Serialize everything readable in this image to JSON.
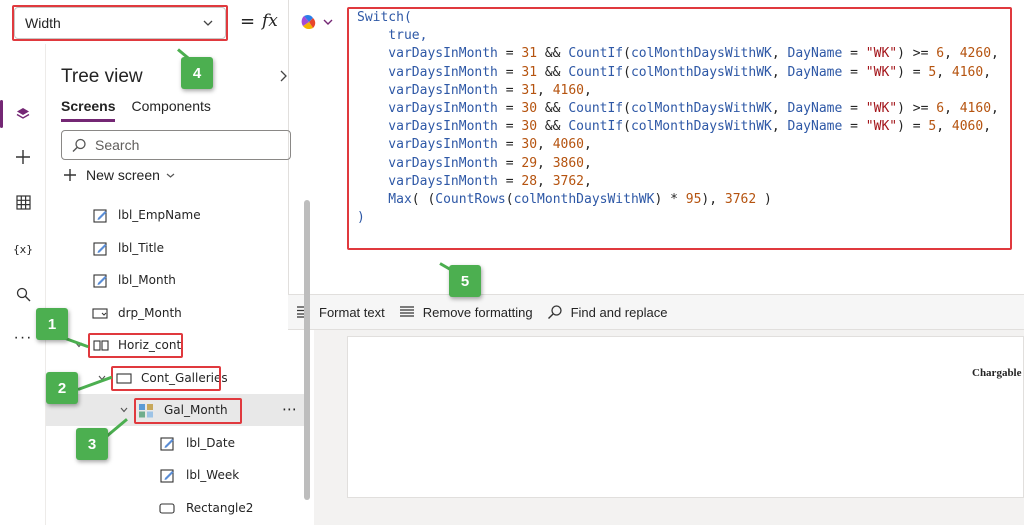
{
  "formula_bar": {
    "property": "Width",
    "equals": "=",
    "fx": "fx"
  },
  "formula": {
    "lines": [
      [
        {
          "t": "Switch(",
          "c": "c-fn"
        }
      ],
      [
        {
          "t": "    true,",
          "c": "c-fn"
        }
      ],
      [
        {
          "t": "    varDaysInMonth",
          "c": "c-id"
        },
        {
          "t": " = ",
          "c": "c-op"
        },
        {
          "t": "31",
          "c": "c-num"
        },
        {
          "t": " && ",
          "c": "c-op"
        },
        {
          "t": "CountIf",
          "c": "c-fn"
        },
        {
          "t": "(",
          "c": "c-op"
        },
        {
          "t": "colMonthDaysWithWK",
          "c": "c-id"
        },
        {
          "t": ", ",
          "c": "c-op"
        },
        {
          "t": "DayName",
          "c": "c-id"
        },
        {
          "t": " = ",
          "c": "c-op"
        },
        {
          "t": "\"WK\"",
          "c": "c-str"
        },
        {
          "t": ") >= ",
          "c": "c-op"
        },
        {
          "t": "6",
          "c": "c-num"
        },
        {
          "t": ", ",
          "c": "c-op"
        },
        {
          "t": "4260",
          "c": "c-num"
        },
        {
          "t": ",",
          "c": "c-op"
        }
      ],
      [
        {
          "t": "    varDaysInMonth",
          "c": "c-id"
        },
        {
          "t": " = ",
          "c": "c-op"
        },
        {
          "t": "31",
          "c": "c-num"
        },
        {
          "t": " && ",
          "c": "c-op"
        },
        {
          "t": "CountIf",
          "c": "c-fn"
        },
        {
          "t": "(",
          "c": "c-op"
        },
        {
          "t": "colMonthDaysWithWK",
          "c": "c-id"
        },
        {
          "t": ", ",
          "c": "c-op"
        },
        {
          "t": "DayName",
          "c": "c-id"
        },
        {
          "t": " = ",
          "c": "c-op"
        },
        {
          "t": "\"WK\"",
          "c": "c-str"
        },
        {
          "t": ") = ",
          "c": "c-op"
        },
        {
          "t": "5",
          "c": "c-num"
        },
        {
          "t": ", ",
          "c": "c-op"
        },
        {
          "t": "4160",
          "c": "c-num"
        },
        {
          "t": ",",
          "c": "c-op"
        }
      ],
      [
        {
          "t": "    varDaysInMonth",
          "c": "c-id"
        },
        {
          "t": " = ",
          "c": "c-op"
        },
        {
          "t": "31",
          "c": "c-num"
        },
        {
          "t": ", ",
          "c": "c-op"
        },
        {
          "t": "4160",
          "c": "c-num"
        },
        {
          "t": ",",
          "c": "c-op"
        }
      ],
      [
        {
          "t": "    varDaysInMonth",
          "c": "c-id"
        },
        {
          "t": " = ",
          "c": "c-op"
        },
        {
          "t": "30",
          "c": "c-num"
        },
        {
          "t": " && ",
          "c": "c-op"
        },
        {
          "t": "CountIf",
          "c": "c-fn"
        },
        {
          "t": "(",
          "c": "c-op"
        },
        {
          "t": "colMonthDaysWithWK",
          "c": "c-id"
        },
        {
          "t": ", ",
          "c": "c-op"
        },
        {
          "t": "DayName",
          "c": "c-id"
        },
        {
          "t": " = ",
          "c": "c-op"
        },
        {
          "t": "\"WK\"",
          "c": "c-str"
        },
        {
          "t": ") >= ",
          "c": "c-op"
        },
        {
          "t": "6",
          "c": "c-num"
        },
        {
          "t": ", ",
          "c": "c-op"
        },
        {
          "t": "4160",
          "c": "c-num"
        },
        {
          "t": ",",
          "c": "c-op"
        }
      ],
      [
        {
          "t": "    varDaysInMonth",
          "c": "c-id"
        },
        {
          "t": " = ",
          "c": "c-op"
        },
        {
          "t": "30",
          "c": "c-num"
        },
        {
          "t": " && ",
          "c": "c-op"
        },
        {
          "t": "CountIf",
          "c": "c-fn"
        },
        {
          "t": "(",
          "c": "c-op"
        },
        {
          "t": "colMonthDaysWithWK",
          "c": "c-id"
        },
        {
          "t": ", ",
          "c": "c-op"
        },
        {
          "t": "DayName",
          "c": "c-id"
        },
        {
          "t": " = ",
          "c": "c-op"
        },
        {
          "t": "\"WK\"",
          "c": "c-str"
        },
        {
          "t": ") = ",
          "c": "c-op"
        },
        {
          "t": "5",
          "c": "c-num"
        },
        {
          "t": ", ",
          "c": "c-op"
        },
        {
          "t": "4060",
          "c": "c-num"
        },
        {
          "t": ",",
          "c": "c-op"
        }
      ],
      [
        {
          "t": "    varDaysInMonth",
          "c": "c-id"
        },
        {
          "t": " = ",
          "c": "c-op"
        },
        {
          "t": "30",
          "c": "c-num"
        },
        {
          "t": ", ",
          "c": "c-op"
        },
        {
          "t": "4060",
          "c": "c-num"
        },
        {
          "t": ",",
          "c": "c-op"
        }
      ],
      [
        {
          "t": "    varDaysInMonth",
          "c": "c-id"
        },
        {
          "t": " = ",
          "c": "c-op"
        },
        {
          "t": "29",
          "c": "c-num"
        },
        {
          "t": ", ",
          "c": "c-op"
        },
        {
          "t": "3860",
          "c": "c-num"
        },
        {
          "t": ",",
          "c": "c-op"
        }
      ],
      [
        {
          "t": "    varDaysInMonth",
          "c": "c-id"
        },
        {
          "t": " = ",
          "c": "c-op"
        },
        {
          "t": "28",
          "c": "c-num"
        },
        {
          "t": ", ",
          "c": "c-op"
        },
        {
          "t": "3762",
          "c": "c-num"
        },
        {
          "t": ",",
          "c": "c-op"
        }
      ],
      [
        {
          "t": "    Max",
          "c": "c-fn"
        },
        {
          "t": "( (",
          "c": "c-op"
        },
        {
          "t": "CountRows",
          "c": "c-fn"
        },
        {
          "t": "(",
          "c": "c-op"
        },
        {
          "t": "colMonthDaysWithWK",
          "c": "c-id"
        },
        {
          "t": ") * ",
          "c": "c-op"
        },
        {
          "t": "95",
          "c": "c-num"
        },
        {
          "t": "), ",
          "c": "c-op"
        },
        {
          "t": "3762",
          "c": "c-num"
        },
        {
          "t": " )",
          "c": "c-op"
        }
      ],
      [
        {
          "t": ")",
          "c": "c-fn"
        }
      ]
    ]
  },
  "format_toolbar": {
    "format_text": "Format text",
    "remove_formatting": "Remove formatting",
    "find_replace": "Find and replace"
  },
  "tree_view": {
    "title": "Tree view",
    "tabs": [
      "Screens",
      "Components"
    ],
    "search_placeholder": "Search",
    "new_screen": "New screen",
    "items": [
      {
        "label": "lbl_EmpName",
        "icon": "label-edit-icon"
      },
      {
        "label": "lbl_Title",
        "icon": "label-edit-icon"
      },
      {
        "label": "lbl_Month",
        "icon": "label-edit-icon"
      },
      {
        "label": "drp_Month",
        "icon": "dropdown-icon"
      },
      {
        "label": "Horiz_cont",
        "icon": "horizontal-container-icon"
      },
      {
        "label": "Cont_Galleries",
        "icon": "container-icon"
      },
      {
        "label": "Gal_Month",
        "icon": "gallery-icon"
      },
      {
        "label": "lbl_Date",
        "icon": "label-edit-icon"
      },
      {
        "label": "lbl_Week",
        "icon": "label-edit-icon"
      },
      {
        "label": "Rectangle2",
        "icon": "rectangle-icon"
      }
    ],
    "more": "⋯"
  },
  "canvas": {
    "chargable": "Chargable"
  },
  "callouts": [
    "1",
    "2",
    "3",
    "4",
    "5"
  ],
  "colors": {
    "accent": "#742774",
    "callout": "#4caf50",
    "highlight": "#e0393e"
  }
}
